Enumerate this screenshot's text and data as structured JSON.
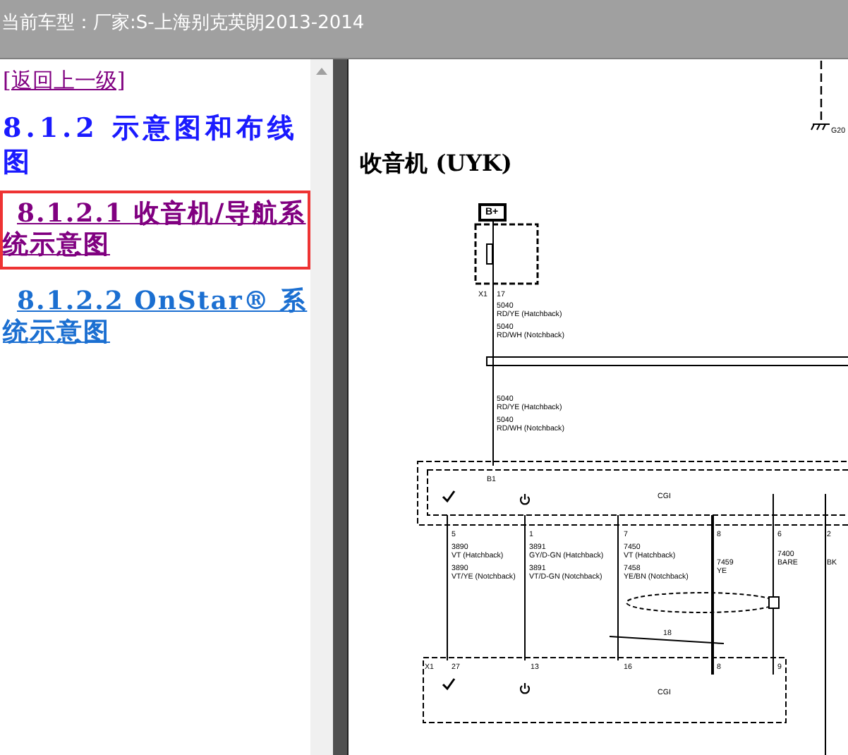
{
  "top_bar": {
    "title": "当前车型：厂家:S-上海别克英朗2013-2014"
  },
  "nav": {
    "links": [
      {
        "text": "[返回上一级]",
        "kind": "back",
        "selected": false
      },
      {
        "text": "8.1.2 示意图和布线图",
        "kind": "heading",
        "selected": false
      },
      {
        "text": "8.1.2.1 收音机/导航系统示意图",
        "kind": "link",
        "selected": true
      },
      {
        "text": "8.1.2.2 OnStar® 系统示意图",
        "kind": "link",
        "selected": false
      }
    ]
  },
  "document": {
    "title": "收音机 (UYK)",
    "labels": [
      {
        "text": "G20"
      },
      {
        "text": "B+"
      },
      {
        "text": "X1"
      },
      {
        "text": "17"
      },
      {
        "text": "5040"
      },
      {
        "text": "RD/YE (Hatchback)"
      },
      {
        "text": "5040"
      },
      {
        "text": "RD/WH (Notchback)"
      },
      {
        "text": "5040"
      },
      {
        "text": "RD/YE (Hatchback)"
      },
      {
        "text": "5040"
      },
      {
        "text": "RD/WH (Notchback)"
      },
      {
        "text": "B1"
      },
      {
        "text": "CGI"
      },
      {
        "text": "5"
      },
      {
        "text": "1"
      },
      {
        "text": "7"
      },
      {
        "text": "8"
      },
      {
        "text": "6"
      },
      {
        "text": "2"
      },
      {
        "text": "3890"
      },
      {
        "text": "VT (Hatchback)"
      },
      {
        "text": "3890"
      },
      {
        "text": "VT/YE (Notchback)"
      },
      {
        "text": "3891"
      },
      {
        "text": "GY/D-GN (Hatchback)"
      },
      {
        "text": "3891"
      },
      {
        "text": "VT/D-GN (Notchback)"
      },
      {
        "text": "7450"
      },
      {
        "text": "VT (Hatchback)"
      },
      {
        "text": "7458"
      },
      {
        "text": "YE/BN (Notchback)"
      },
      {
        "text": "7459"
      },
      {
        "text": "YE"
      },
      {
        "text": "7400"
      },
      {
        "text": "BARE"
      },
      {
        "text": "BK"
      },
      {
        "text": "18"
      },
      {
        "text": "X1"
      },
      {
        "text": "27"
      },
      {
        "text": "13"
      },
      {
        "text": "16"
      },
      {
        "text": "8"
      },
      {
        "text": "9"
      },
      {
        "text": "CGI"
      }
    ]
  }
}
